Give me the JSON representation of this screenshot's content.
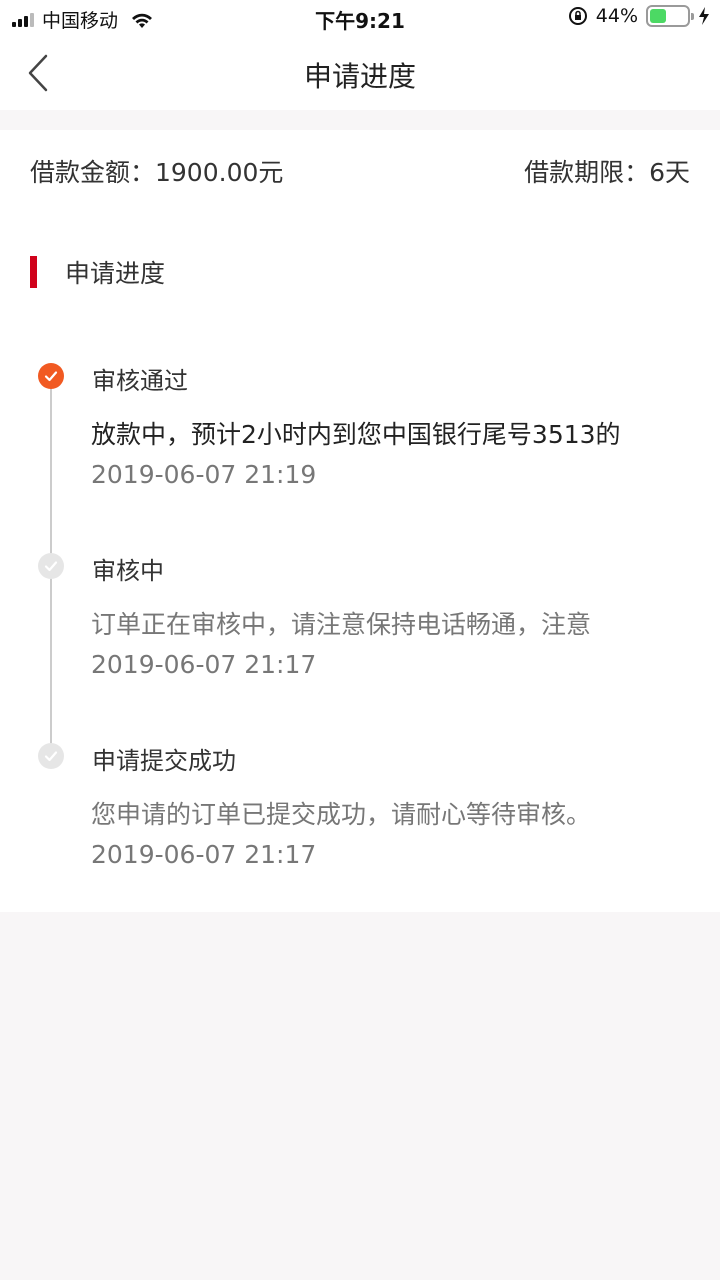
{
  "status_bar": {
    "carrier": "中国移动",
    "time": "下午9:21",
    "battery_percent": "44%",
    "battery_level": 0.44
  },
  "nav": {
    "title": "申请进度",
    "back_icon": "chevron-left-icon"
  },
  "loan": {
    "amount_label": "借款金额：1900.00元",
    "term_label": "借款期限：6天"
  },
  "section": {
    "title": "申请进度"
  },
  "steps": [
    {
      "title": "审核通过",
      "description": "放款中，预计2小时内到您中国银行尾号3513的",
      "time": "2019-06-07 21:19",
      "state": "active"
    },
    {
      "title": "审核中",
      "description": "订单正在审核中，请注意保持电话畅通，注意",
      "time": "2019-06-07 21:17",
      "state": "done"
    },
    {
      "title": "申请提交成功",
      "description": "您申请的订单已提交成功，请耐心等待审核。",
      "time": "2019-06-07 21:17",
      "state": "done"
    }
  ],
  "colors": {
    "accent": "#f15a22",
    "section_bar": "#d0021b",
    "background": "#f8f6f7"
  }
}
